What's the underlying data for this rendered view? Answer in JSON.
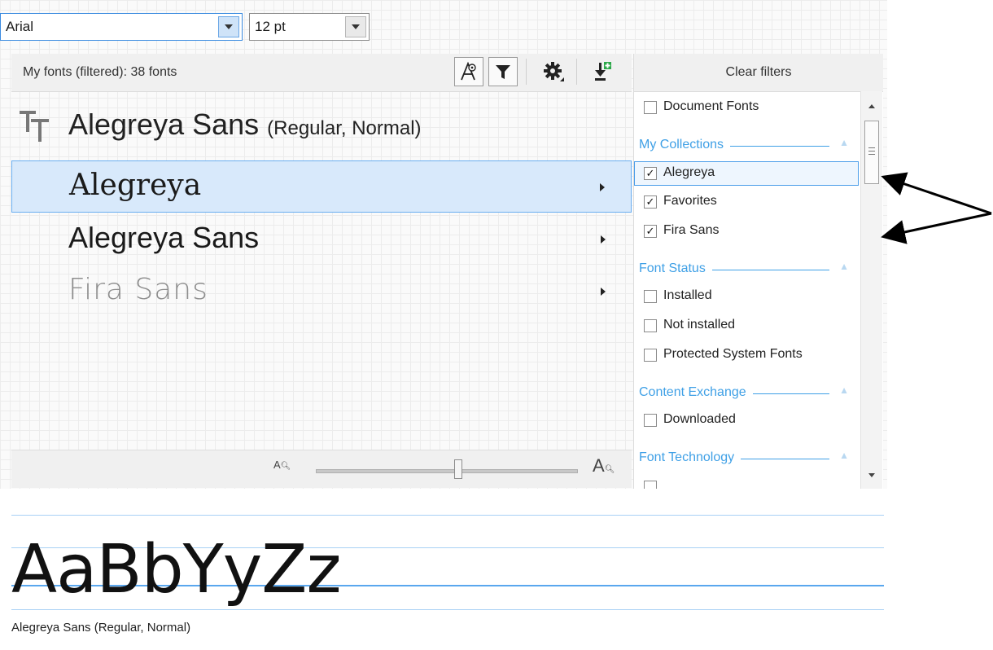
{
  "toolbar": {
    "font_value": "Arial",
    "size_value": "12 pt"
  },
  "list": {
    "count_label": "My fonts (filtered): 38 fonts",
    "heading": {
      "name": "Alegreya Sans",
      "style": "(Regular, Normal)"
    },
    "items": [
      {
        "label": "Alegreya",
        "selected": true
      },
      {
        "label": "Alegreya Sans",
        "selected": false
      },
      {
        "label": "Fira Sans",
        "selected": false
      }
    ],
    "zoom_small": "A",
    "zoom_large": "A"
  },
  "filters": {
    "clear_label": "Clear filters",
    "document_fonts": {
      "label": "Document Fonts",
      "checked": false
    },
    "sections": {
      "collections": "My Collections",
      "status": "Font Status",
      "exchange": "Content Exchange",
      "technology": "Font Technology"
    },
    "collections": [
      {
        "label": "Alegreya",
        "checked": true,
        "check": "✓"
      },
      {
        "label": "Favorites",
        "checked": true,
        "check": "✓"
      },
      {
        "label": "Fira Sans",
        "checked": true,
        "check": "✓"
      }
    ],
    "status": [
      {
        "label": "Installed",
        "checked": false
      },
      {
        "label": "Not installed",
        "checked": false
      },
      {
        "label": "Protected System Fonts",
        "checked": false
      }
    ],
    "exchange": [
      {
        "label": "Downloaded",
        "checked": false
      }
    ]
  },
  "preview": {
    "sample": "AaBbYyZz",
    "caption": "Alegreya Sans (Regular, Normal)"
  },
  "colors": {
    "accent": "#3fa0e6",
    "selection": "#d8e9fb"
  }
}
